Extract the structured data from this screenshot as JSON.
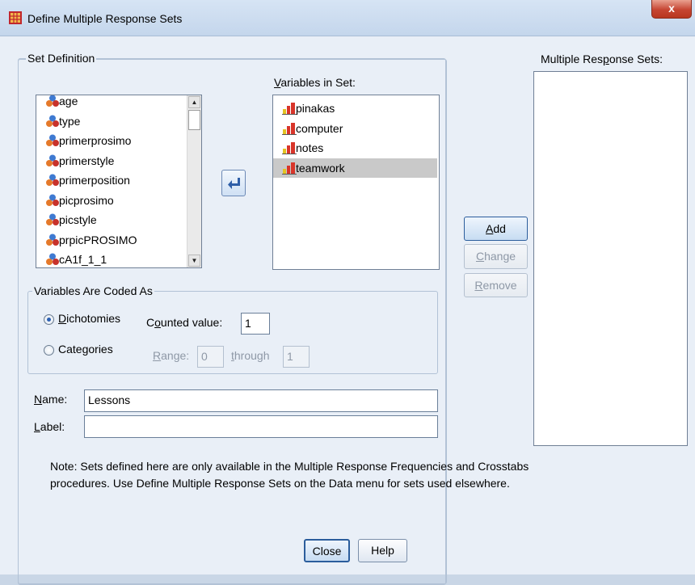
{
  "window": {
    "title": "Define Multiple Response Sets",
    "close_glyph": "x"
  },
  "set_definition": {
    "legend": "Set Definition",
    "source_variables": [
      {
        "name": "age",
        "icon": "nominal-icon"
      },
      {
        "name": "type",
        "icon": "nominal-icon"
      },
      {
        "name": "primerprosimo",
        "icon": "nominal-icon"
      },
      {
        "name": "primerstyle",
        "icon": "nominal-icon"
      },
      {
        "name": "primerposition",
        "icon": "nominal-icon"
      },
      {
        "name": "picprosimo",
        "icon": "nominal-icon"
      },
      {
        "name": "picstyle",
        "icon": "nominal-icon"
      },
      {
        "name": "prpicPROSIMO",
        "icon": "nominal-icon"
      },
      {
        "name": "cA1f_1_1",
        "icon": "nominal-icon"
      }
    ],
    "move_button_icon": "arrow-left-icon",
    "variables_in_set_label": "Variables in Set:",
    "variables_in_set": [
      {
        "name": "pinakas",
        "icon": "scale-icon",
        "selected": false
      },
      {
        "name": "computer",
        "icon": "scale-icon",
        "selected": false
      },
      {
        "name": "notes",
        "icon": "scale-icon",
        "selected": false
      },
      {
        "name": "teamwork",
        "icon": "scale-icon",
        "selected": true
      }
    ]
  },
  "coded_as": {
    "legend": "Variables Are Coded As",
    "dichotomies_label": "Dichotomies",
    "dichotomies_selected": true,
    "counted_value_label": "Counted value:",
    "counted_value": "1",
    "categories_label": "Categories",
    "categories_selected": false,
    "range_label": "Range:",
    "range_from": "0",
    "through_label": "through",
    "range_to": "1"
  },
  "name_field": {
    "label": "Name:",
    "value": "Lessons"
  },
  "label_field": {
    "label": "Label:",
    "value": ""
  },
  "actions": {
    "add": "Add",
    "change": "Change",
    "remove": "Remove"
  },
  "multiple_response_sets_label": "Multiple Response Sets:",
  "multiple_response_sets": [],
  "note_line1": "Note: Sets defined here are only available in the Multiple Response Frequencies and Crosstabs",
  "note_line2": "procedures. Use Define Multiple Response Sets on the Data menu for sets used elsewhere.",
  "footer": {
    "close": "Close",
    "help": "Help"
  },
  "colors": {
    "title_bar": "#c9d9ee",
    "dialog_bg": "#e9eff7",
    "close_red": "#c64532",
    "selection": "#c9c9c9",
    "radio_dot": "#2c61b4"
  }
}
